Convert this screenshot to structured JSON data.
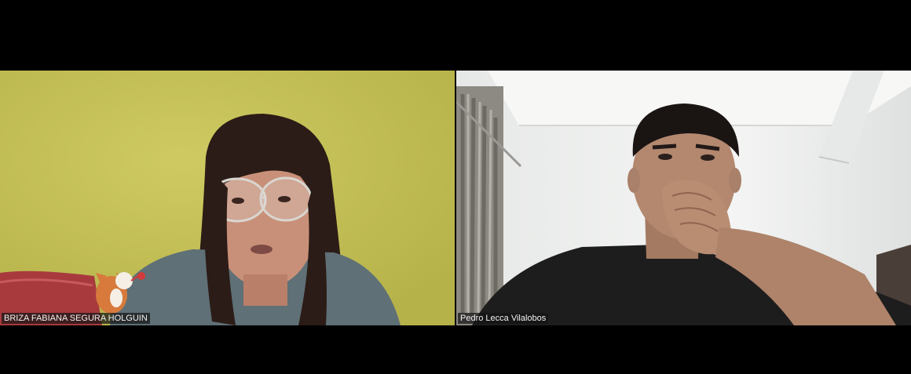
{
  "participants": [
    {
      "name": "BRIZA FABIANA SEGURA HOLGUIN",
      "video": "on"
    },
    {
      "name": "Pedro Lecca Vilalobos",
      "video": "on"
    }
  ],
  "colors": {
    "background": "#000000",
    "label_bg": "#141414"
  }
}
